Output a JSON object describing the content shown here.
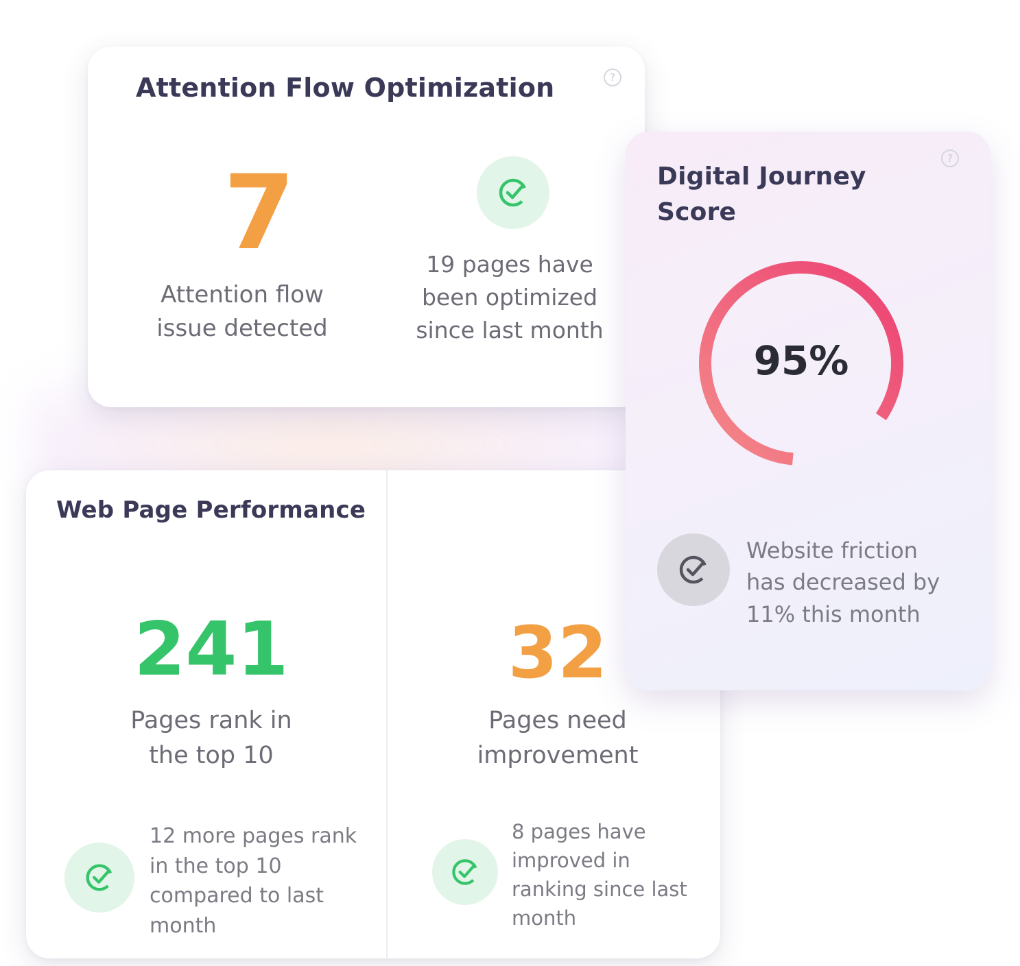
{
  "attention_card": {
    "title": "Attention Flow Optimization",
    "help_icon": "?",
    "issues_count": "7",
    "issues_label_line1": "Attention flow",
    "issues_label_line2": "issue detected",
    "optimized_line1": "19 pages have",
    "optimized_line2": "been optimized",
    "optimized_line3": "since last month",
    "accent_orange": "#f3a044",
    "accent_green": "#35c46a"
  },
  "journey_card": {
    "title_line1": "Digital Journey",
    "title_line2": "Score",
    "help_icon": "?",
    "score_text": "95%",
    "score_value": 0.95,
    "friction_line1": "Website friction",
    "friction_line2": "has decreased by",
    "friction_line3": "11% this month",
    "ring_colors": [
      "#f48a8a",
      "#ec3f72"
    ]
  },
  "web_card": {
    "title": "Web Page Performance",
    "left": {
      "count": "241",
      "label_line1": "Pages rank in",
      "label_line2": "the top 10",
      "note_line1": "12 more pages rank",
      "note_line2": "in the top 10",
      "note_line3": "compared  to last",
      "note_line4": "month",
      "accent": "#35c46a"
    },
    "right": {
      "count": "32",
      "label_line1": "Pages need",
      "label_line2": "improvement",
      "note_line1": "8 pages have",
      "note_line2": "improved in",
      "note_line3": "ranking since last",
      "note_line4": "month",
      "accent": "#f3a044"
    }
  },
  "icons": {
    "check": "check-circle-icon",
    "help": "help-icon"
  }
}
